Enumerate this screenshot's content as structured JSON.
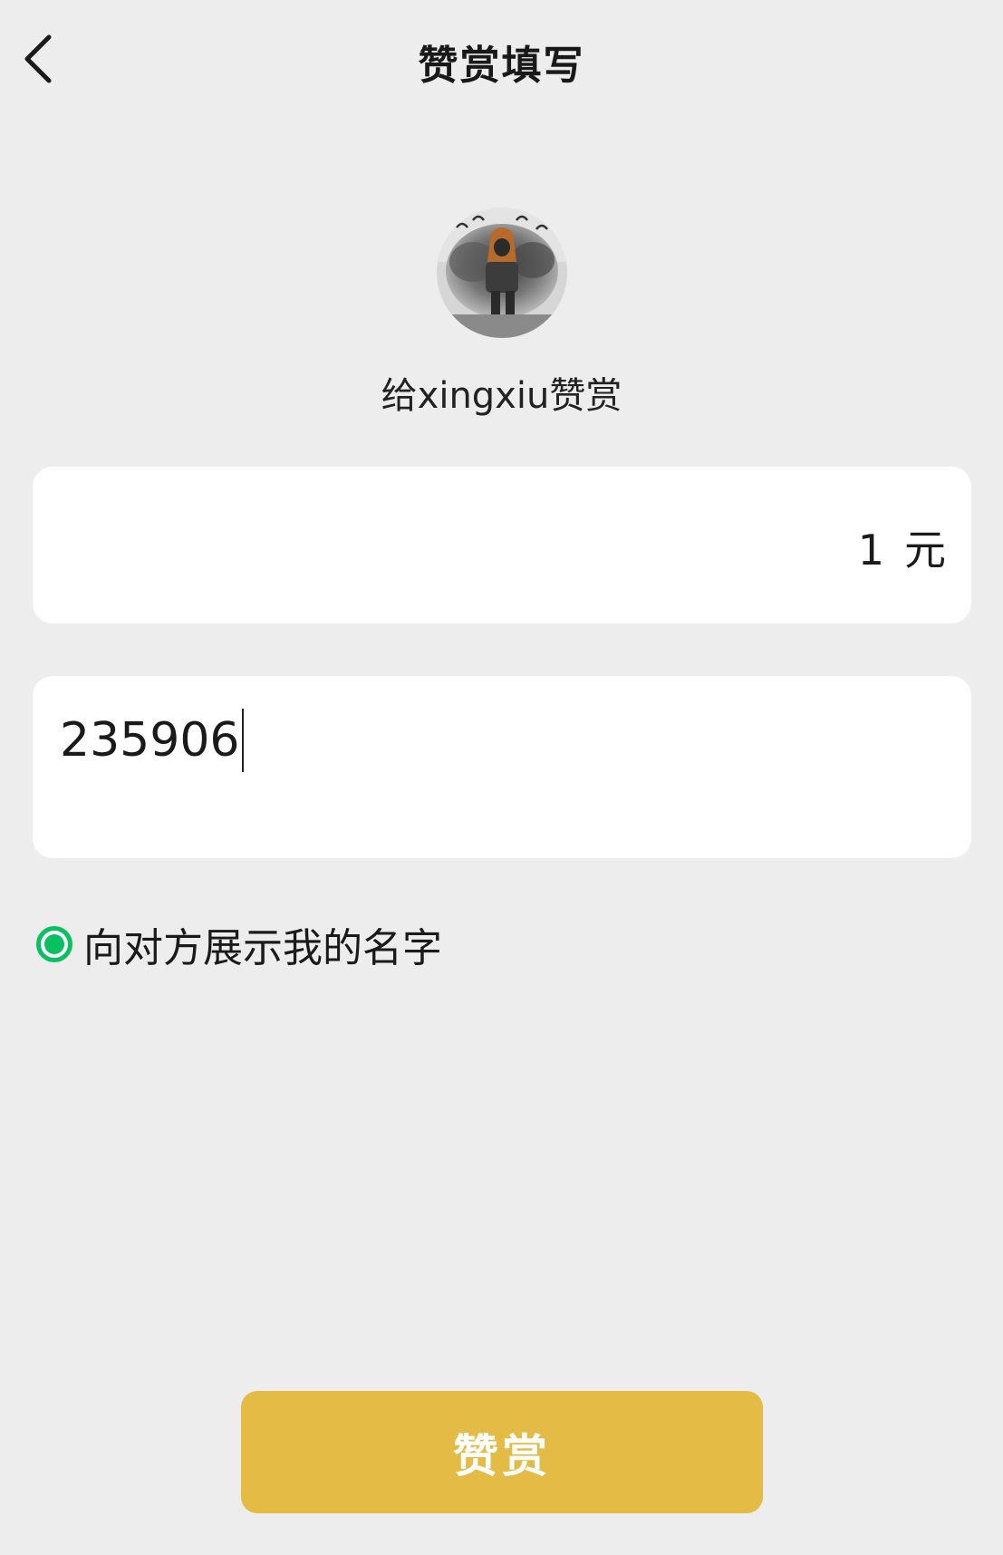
{
  "header": {
    "title": "赞赏填写",
    "back_icon": "chevron-left-icon"
  },
  "recipient": {
    "text": "给xingxiu赞赏"
  },
  "amount": {
    "value": "1",
    "unit": "元"
  },
  "message": {
    "value": "235906"
  },
  "show_name": {
    "label": "向对方展示我的名字",
    "checked": true
  },
  "submit": {
    "label": "赞赏"
  },
  "colors": {
    "background": "#ededed",
    "card": "#ffffff",
    "accent_green": "#07c160",
    "button_gold": "#e3bb45",
    "button_text": "#ffffff"
  }
}
